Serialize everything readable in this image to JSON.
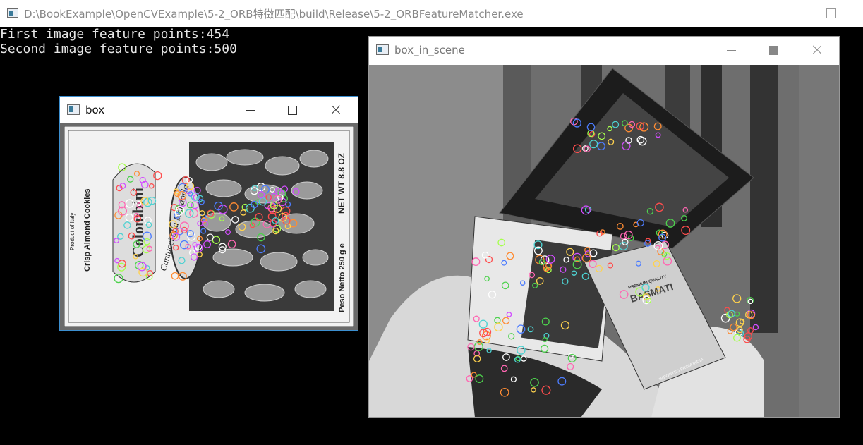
{
  "console": {
    "title": "D:\\BookExample\\OpenCVExample\\5-2_ORB特徵匹配\\build\\Release\\5-2_ORBFeatureMatcher.exe",
    "lines": [
      "First image feature points:454",
      "Second image feature points:500"
    ]
  },
  "box_window": {
    "title": "box",
    "image_text": {
      "brand": "Colombini",
      "product_line": "Crisp Almond Cookies",
      "origin": "Product of Italy",
      "tagline": "Cantucci alla Mandorla",
      "net_wt": "NET WT 8.8 OZ",
      "peso": "Peso Netto 250 g e"
    }
  },
  "scene_window": {
    "title": "box_in_scene",
    "image_text": {
      "rice_box": "BASMATI",
      "rice_box_top": "PREMIUM QUALITY",
      "rice_box_bottom": "IMPORTED FROM INDIA"
    }
  },
  "icons": {
    "window": "app-window-icon",
    "minimize": "minimize-icon",
    "maximize": "maximize-icon",
    "close": "close-icon"
  },
  "keypoint_colors": [
    "#ff4d4d",
    "#4dd24d",
    "#4d7dff",
    "#ffd24d",
    "#d24dff",
    "#4dd2d2",
    "#ff8c33",
    "#ff66b2",
    "#a6ff4d",
    "#ffffff"
  ]
}
